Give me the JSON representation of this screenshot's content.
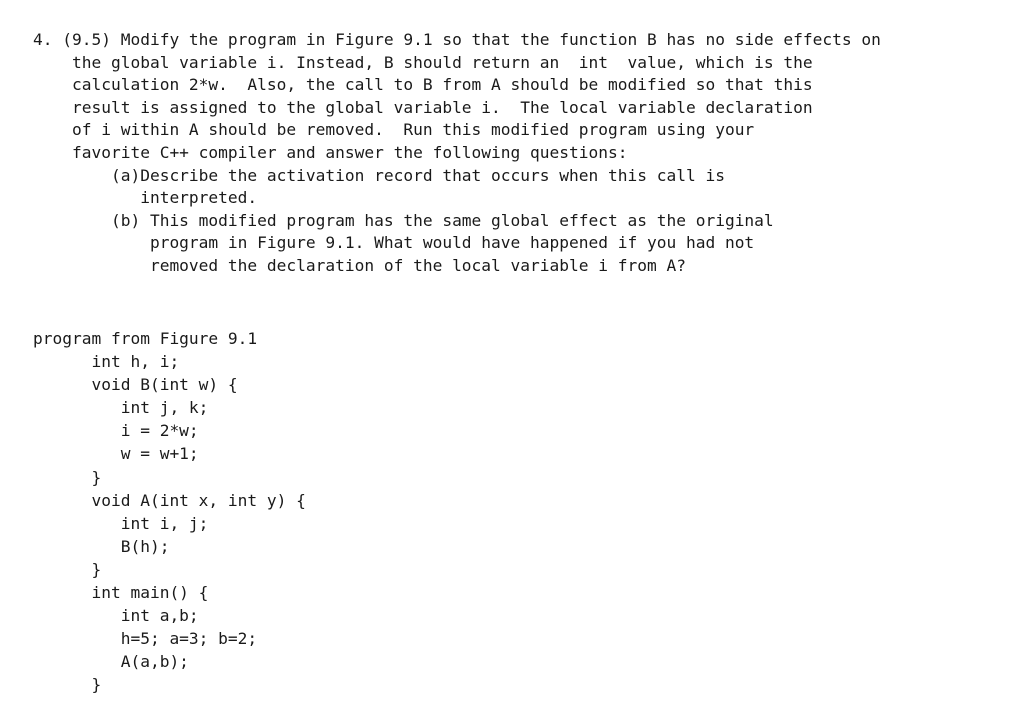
{
  "document": {
    "background_color": "#ffffff",
    "text_color": "#1a1a1a"
  },
  "question": {
    "number": "4.",
    "reference": "(9.5)",
    "lines": [
      "4. (9.5) Modify the program in Figure 9.1 so that the function B has no side effects on",
      "    the global variable i. Instead, B should return an  int  value, which is the",
      "    calculation 2*w.  Also, the call to B from A should be modified so that this",
      "    result is assigned to the global variable i.  The local variable declaration",
      "    of i within A should be removed.  Run this modified program using your",
      "    favorite C++ compiler and answer the following questions:",
      "        (a)Describe the activation record that occurs when this call is",
      "           interpreted.",
      "        (b) This modified program has the same global effect as the original",
      "            program in Figure 9.1. What would have happened if you had not",
      "            removed the declaration of the local variable i from A?"
    ],
    "sub_items": [
      {
        "label": "(a)",
        "text": "Describe the activation record that occurs when this call is interpreted."
      },
      {
        "label": "(b)",
        "text": "This modified program has the same global effect as the original program in Figure 9.1. What would have happened if you had not removed the declaration of the local variable i from A?"
      }
    ]
  },
  "code": {
    "caption": "program from Figure 9.1",
    "language": "C++",
    "lines": [
      "program from Figure 9.1",
      "      int h, i;",
      "      void B(int w) {",
      "         int j, k;",
      "         i = 2*w;",
      "         w = w+1;",
      "      }",
      "      void A(int x, int y) {",
      "         int i, j;",
      "         B(h);",
      "      }",
      "      int main() {",
      "         int a,b;",
      "         h=5; a=3; b=2;",
      "         A(a,b);",
      "      }"
    ]
  }
}
